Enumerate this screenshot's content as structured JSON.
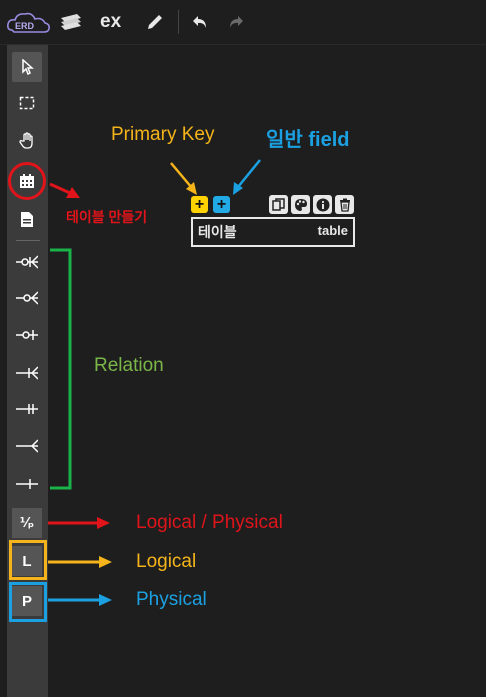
{
  "header": {
    "logo_text": "ERD",
    "title": "ex"
  },
  "sidebar": {
    "logical_physical_label": "⅟ₚ",
    "logical_label": "L",
    "physical_label": "P"
  },
  "table_widget": {
    "pk_button_label": "+",
    "field_button_label": "+",
    "table_name": "테이블",
    "table_comment": "table"
  },
  "annotations": {
    "primary_key": "Primary Key",
    "field": "일반 field",
    "create_table": "테이블 만들기",
    "relation": "Relation",
    "logical_physical": "Logical / Physical",
    "logical": "Logical",
    "physical": "Physical"
  },
  "colors": {
    "red": "#e0141a",
    "yellow": "#f5b41a",
    "blue": "#1ba1e2",
    "green": "#19b34a",
    "relation_text": "#7ab648",
    "primary_key_text": "#f5b41a",
    "field_text": "#1ba1e2"
  }
}
